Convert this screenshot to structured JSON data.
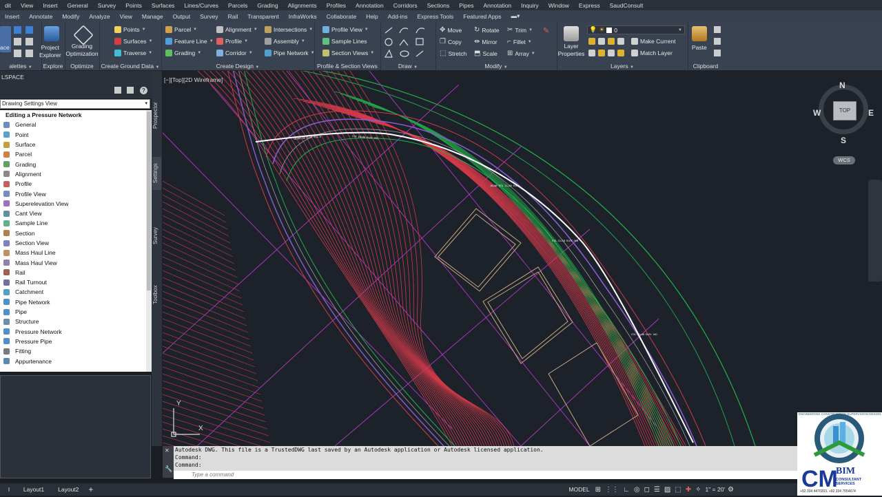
{
  "menu_row1": [
    "dit",
    "View",
    "Insert",
    "General",
    "Survey",
    "Points",
    "Surfaces",
    "Lines/Curves",
    "Parcels",
    "Grading",
    "Alignments",
    "Profiles",
    "Annotation",
    "Corridors",
    "Sections",
    "Pipes",
    "Annotation",
    "Inquiry",
    "Window",
    "Express",
    "SaudConsult"
  ],
  "menu_row2": [
    "Insert",
    "Annotate",
    "Modify",
    "Analyze",
    "View",
    "Manage",
    "Output",
    "Survey",
    "Rail",
    "Transparent",
    "InfraWorks",
    "Collaborate",
    "Help",
    "Add-ins",
    "Express Tools",
    "Featured Apps"
  ],
  "ribbon": {
    "palettes_btn": "ace",
    "palettes_title": "alettes",
    "explore": {
      "btn": "Project Explorer",
      "btn_line1": "Project",
      "btn_line2": "Explorer",
      "title": "Explore"
    },
    "optimize": {
      "btn_line1": "Grading",
      "btn_line2": "Optimization",
      "title": "Optimize"
    },
    "ground": {
      "items": [
        "Points",
        "Surfaces",
        "Traverse"
      ],
      "title": "Create Ground Data"
    },
    "design": {
      "col1": [
        "Parcel",
        "Feature Line",
        "Grading"
      ],
      "col2": [
        "Alignment",
        "Profile",
        "Corridor"
      ],
      "col3": [
        "Intersections",
        "Assembly",
        "Pipe Network"
      ],
      "title": "Create Design"
    },
    "profile_section": {
      "items": [
        "Profile View",
        "Sample Lines",
        "Section Views"
      ],
      "title": "Profile & Section Views"
    },
    "draw": {
      "title": "Draw"
    },
    "modify": {
      "col1": [
        "Move",
        "Copy",
        "Stretch"
      ],
      "col2": [
        "Rotate",
        "Mirror",
        "Scale"
      ],
      "col3": [
        "Trim",
        "Fillet",
        "Array"
      ],
      "title": "Modify"
    },
    "layers": {
      "btn_line1": "Layer",
      "btn_line2": "Properties",
      "current_layer": "0",
      "make_current": "Make Current",
      "match_layer": "Match Layer",
      "title": "Layers"
    },
    "clipboard": {
      "paste": "Paste",
      "title": "Clipboard"
    }
  },
  "palette": {
    "header": "LSPACE",
    "view_select": "Drawing Settings View",
    "root": "Editing a Pressure Network",
    "items": [
      "General",
      "Point",
      "Surface",
      "Parcel",
      "Grading",
      "Alignment",
      "Profile",
      "Profile View",
      "Superelevation View",
      "Cant View",
      "Sample Line",
      "Section",
      "Section View",
      "Mass Haul Line",
      "Mass Haul View",
      "Rail",
      "Rail Turnout",
      "Catchment",
      "Pipe Network",
      "Pipe",
      "Structure",
      "Pressure Network",
      "Pressure Pipe",
      "Fitting",
      "Appurtenance"
    ],
    "vertical_tabs": [
      "Prospector",
      "Settings",
      "Survey",
      "Toolbox"
    ]
  },
  "canvas": {
    "view_label": "[−][Top][2D Wireframe]"
  },
  "viewcube": {
    "n": "N",
    "s": "S",
    "e": "E",
    "w": "W",
    "top": "TOP",
    "wcs": "WCS"
  },
  "ucs": {
    "x": "X",
    "y": "Y"
  },
  "command": {
    "history": [
      "Autodesk DWG.  This file is a TrustedDWG last saved by an Autodesk application or Autodesk licensed application.",
      "Command:",
      "Command:"
    ],
    "placeholder": "Type a command"
  },
  "status": {
    "tabs": [
      "Layout1",
      "Layout2"
    ],
    "model": "MODEL",
    "scale": "1\" = 20'"
  },
  "logo": {
    "word": "BIM",
    "sub": "CONSULTANT SERVICES",
    "phones": "+92 334 4470203, +92 334 7054674",
    "ring": "ENGINEERING CONSTRUCTION SUPERVISION DESIGN"
  },
  "colors": {
    "canvas_bg": "#1d222a",
    "ribbon_bg": "#394251",
    "contour_red": "#d23a4a",
    "contour_green": "#22b04a",
    "magenta": "#c23ad0"
  }
}
